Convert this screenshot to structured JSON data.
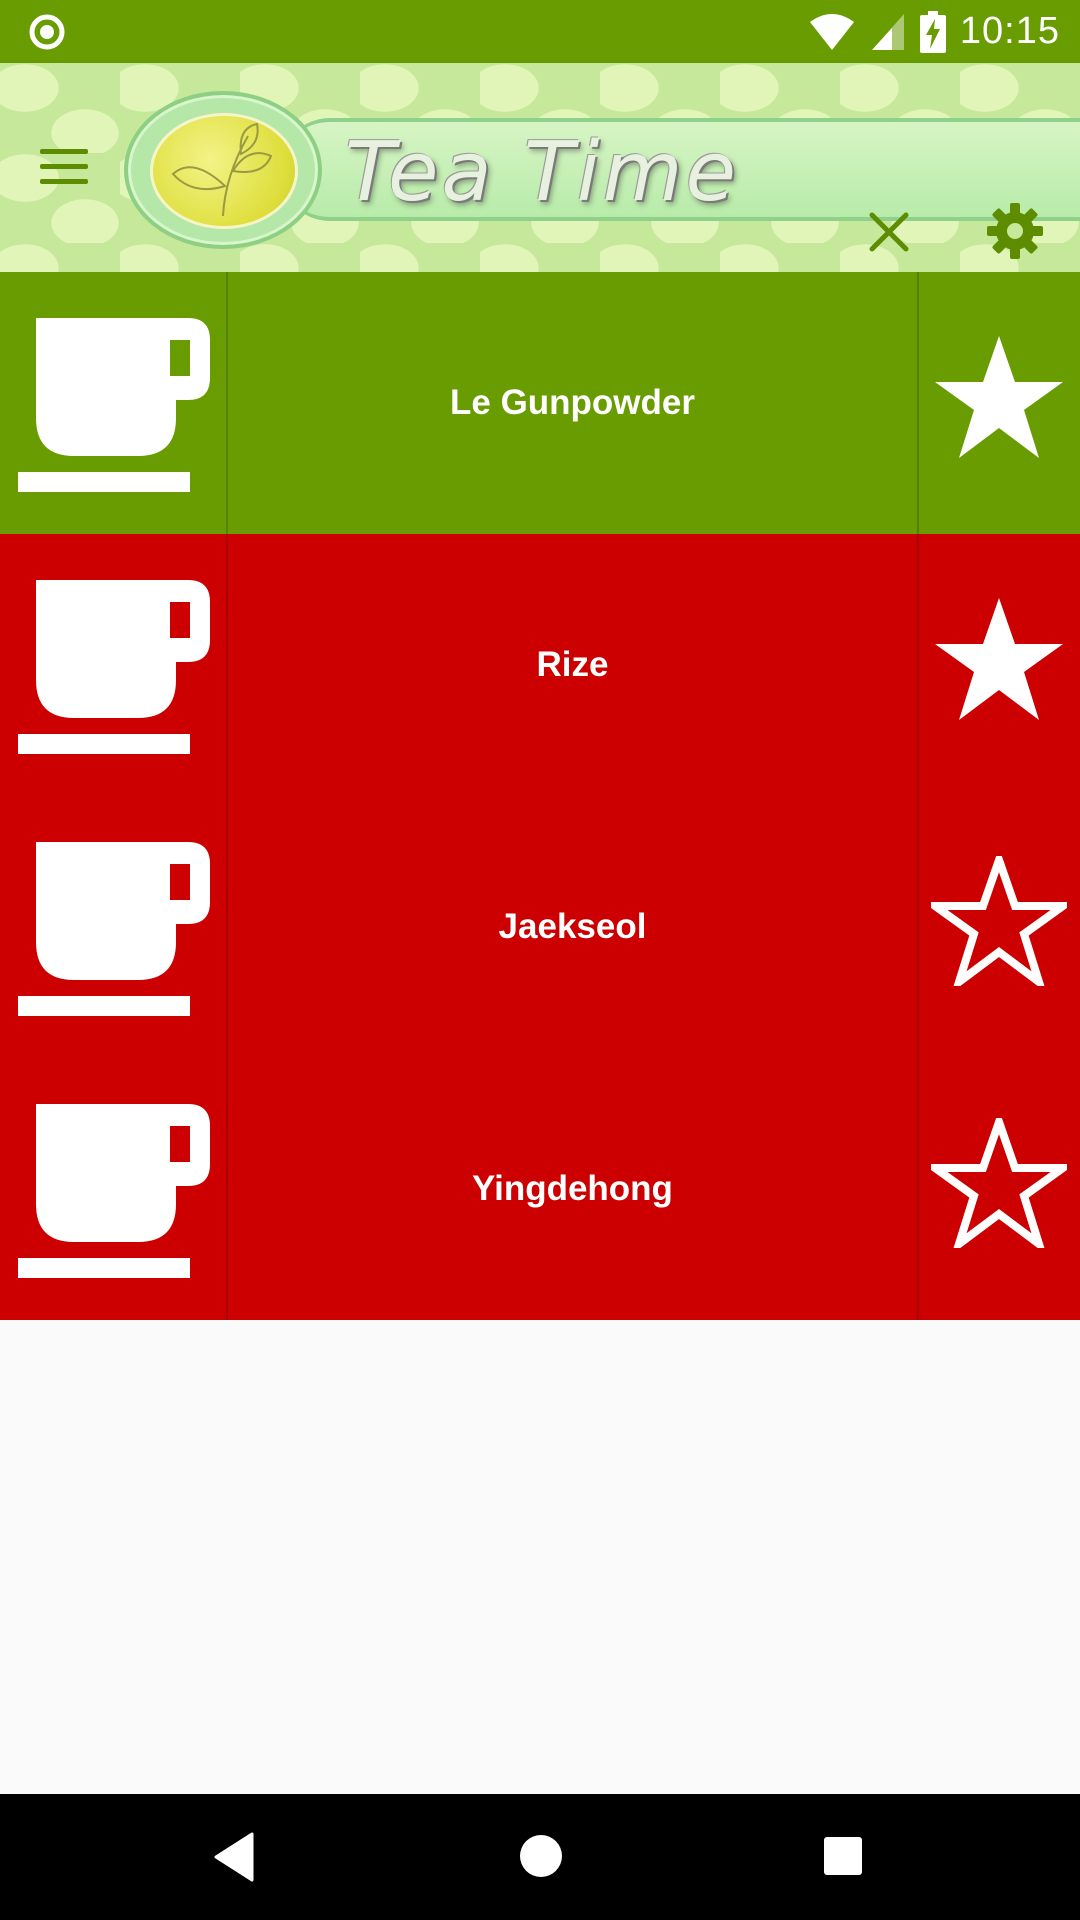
{
  "status_bar": {
    "time": "10:15",
    "icons": [
      "sync-circle-icon",
      "wifi-icon",
      "cellular-signal-icon",
      "battery-charging-icon"
    ]
  },
  "app_bar": {
    "title": "Tea Time",
    "menu_icon": "hamburger-menu-icon",
    "logo_icon": "tea-leaf-logo-icon",
    "close_icon": "close-icon",
    "settings_icon": "gear-icon",
    "colors": {
      "accent": "#5e8c00",
      "background": "#c6e89a"
    }
  },
  "teas": [
    {
      "name": "Le Gunpowder",
      "favorite": true,
      "color": "#689c00"
    },
    {
      "name": "Rize",
      "favorite": true,
      "color": "#cc0000"
    },
    {
      "name": "Jaekseol",
      "favorite": false,
      "color": "#cc0000"
    },
    {
      "name": "Yingdehong",
      "favorite": false,
      "color": "#cc0000"
    }
  ],
  "nav_bar": {
    "icons": [
      "back-icon",
      "home-icon",
      "recents-icon"
    ]
  }
}
